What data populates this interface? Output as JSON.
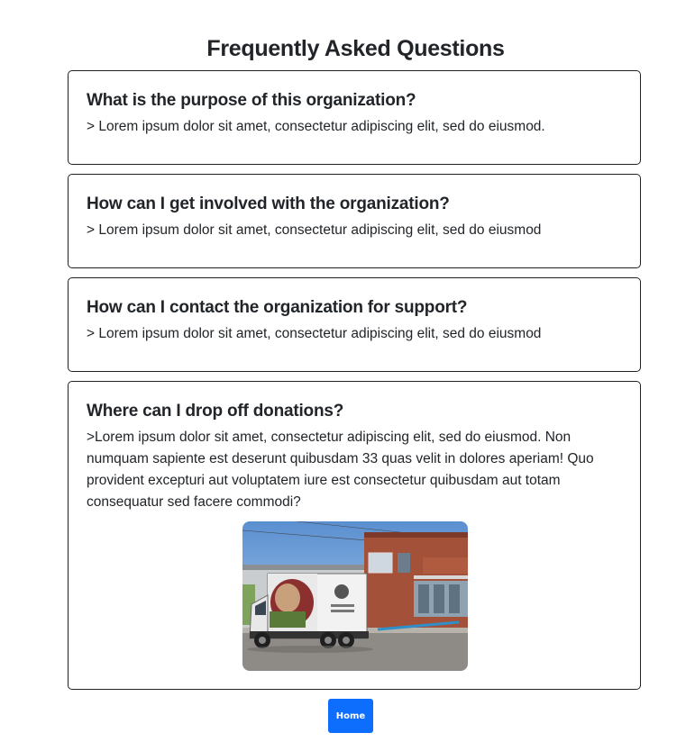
{
  "page": {
    "title": "Frequently Asked Questions"
  },
  "faq": [
    {
      "question": "What is the purpose of this organization?",
      "answer": "> Lorem ipsum dolor sit amet, consectetur adipiscing elit, sed do eiusmod."
    },
    {
      "question": "How can I get involved with the organization?",
      "answer": "> Lorem ipsum dolor sit amet, consectetur adipiscing elit, sed do eiusmod"
    },
    {
      "question": "How can I contact the organization for support?",
      "answer": "> Lorem ipsum dolor sit amet, consectetur adipiscing elit, sed do eiusmod"
    },
    {
      "question": "Where can I drop off donations?",
      "answer": ">Lorem ipsum dolor sit amet, consectetur adipiscing elit, sed do eiusmod. Non numquam sapiente est deserunt quibusdam 33 quas velit in dolores aperiam! Quo provident excepturi aut voluptatem iure est consectetur quibusdam aut totam consequatur sed facere commodi?"
    }
  ],
  "nav": {
    "home_label": "Home"
  },
  "colors": {
    "accent": "#0d6efd",
    "text": "#212529",
    "border": "#222222"
  }
}
